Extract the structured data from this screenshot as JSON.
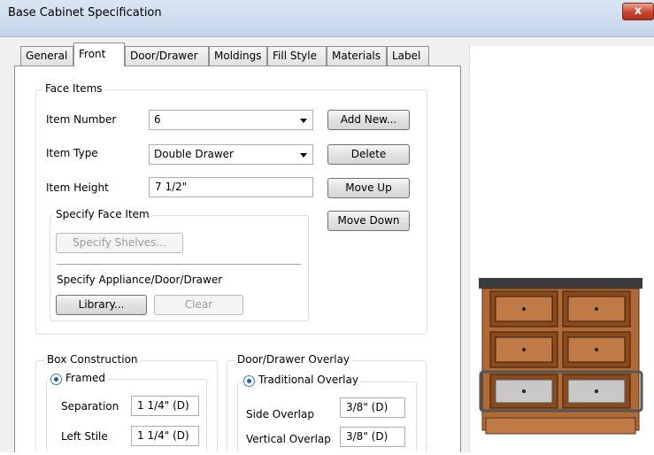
{
  "window": {
    "title": "Base Cabinet Specification",
    "close_glyph": "x"
  },
  "tabs": [
    {
      "label": "General"
    },
    {
      "label": "Front"
    },
    {
      "label": "Door/Drawer"
    },
    {
      "label": "Moldings"
    },
    {
      "label": "Fill Style"
    },
    {
      "label": "Materials"
    },
    {
      "label": "Label"
    }
  ],
  "face_items": {
    "legend": "Face Items",
    "item_number": {
      "label": "Item Number",
      "value": "6"
    },
    "item_type": {
      "label": "Item Type",
      "value": "Double Drawer"
    },
    "item_height": {
      "label": "Item Height",
      "value": "7 1/2\""
    },
    "buttons": {
      "add_new": "Add New...",
      "delete": "Delete",
      "move_up": "Move Up",
      "move_down": "Move Down"
    },
    "specify": {
      "legend": "Specify Face Item",
      "shelves_button": "Specify Shelves...",
      "appliance_label": "Specify Appliance/Door/Drawer",
      "library_button": "Library...",
      "clear_button": "Clear"
    }
  },
  "box_construction": {
    "legend": "Box Construction",
    "framed_label": "Framed",
    "separation": {
      "label": "Separation",
      "value": "1 1/4\" (D)"
    },
    "left_stile": {
      "label": "Left Stile",
      "value": "1 1/4\" (D)"
    }
  },
  "overlay": {
    "legend": "Door/Drawer Overlay",
    "traditional_label": "Traditional Overlay",
    "side_overlap": {
      "label": "Side Overlap",
      "value": "3/8\" (D)"
    },
    "vertical_overlap": {
      "label": "Vertical Overlap",
      "value": "3/8\" (D)"
    }
  },
  "colors": {
    "cabinet_wood": "#b06a35",
    "countertop": "#3b3b3b",
    "selected_drawer": "#c8c8c8"
  }
}
